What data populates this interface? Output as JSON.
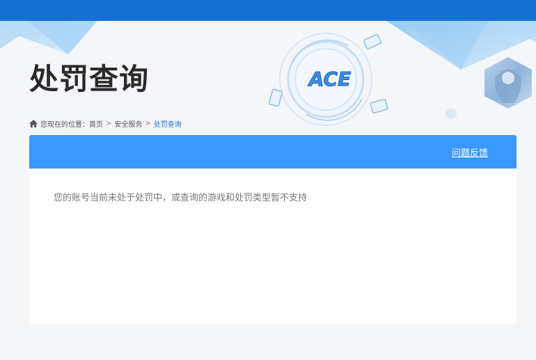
{
  "page": {
    "title": "处罚查询",
    "logo_text": "ACE"
  },
  "breadcrumb": {
    "prefix": "您现在的位置：",
    "items": [
      "首页",
      "安全服务"
    ],
    "separator": ">",
    "current": "处罚查询"
  },
  "panel": {
    "feedback_link": "问题反馈",
    "message": "您的账号当前未处于处罚中，或查询的游戏和处罚类型暂不支持"
  },
  "colors": {
    "topbar": "#1570d6",
    "panel_header": "#3a97ff",
    "breadcrumb_current": "#1a74d8",
    "page_background": "#f5f6f8"
  },
  "icons": {
    "breadcrumb": "home-icon",
    "banner_logo": "ace-logo-icon",
    "banner_character": "character-avatar"
  }
}
